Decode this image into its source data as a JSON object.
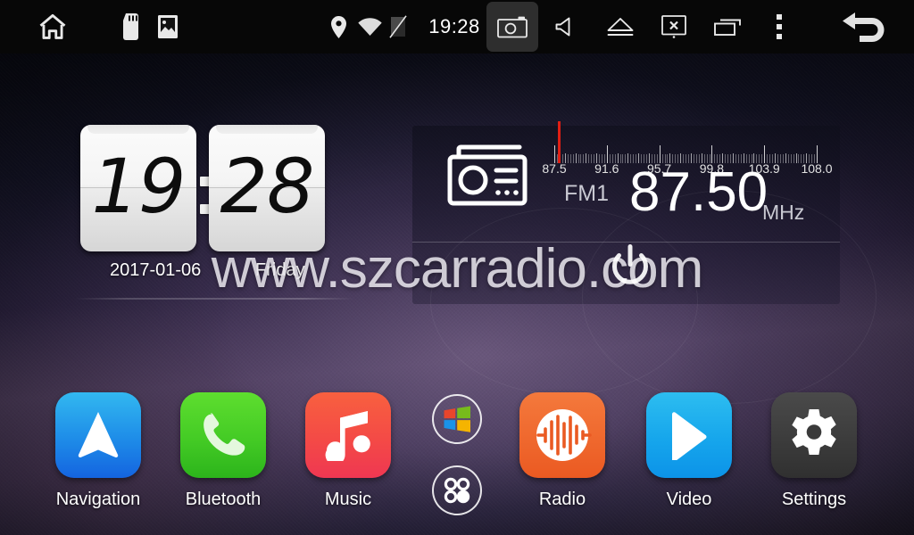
{
  "statusbar": {
    "time": "19:28",
    "icons_left": [
      {
        "name": "home-icon",
        "label": "Home"
      },
      {
        "name": "sd-card-icon",
        "label": "SD Card"
      },
      {
        "name": "gallery-icon",
        "label": "Gallery"
      }
    ],
    "icons_center": [
      {
        "name": "location-pin-icon",
        "label": "Location"
      },
      {
        "name": "wifi-icon",
        "label": "Wi-Fi"
      },
      {
        "name": "sim-off-icon",
        "label": "No SIM"
      }
    ],
    "icons_right": [
      {
        "name": "camera-icon",
        "label": "Camera"
      },
      {
        "name": "volume-icon",
        "label": "Volume"
      },
      {
        "name": "eject-icon",
        "label": "Eject"
      },
      {
        "name": "screen-off-icon",
        "label": "Screen Off"
      },
      {
        "name": "recent-apps-icon",
        "label": "Recent Apps"
      },
      {
        "name": "overflow-menu-icon",
        "label": "More"
      },
      {
        "name": "back-icon",
        "label": "Back"
      }
    ]
  },
  "clock": {
    "hours": "19",
    "minutes": "28",
    "date": "2017-01-06",
    "weekday": "Friday"
  },
  "radio": {
    "icon_name": "radio-icon",
    "band": "FM1",
    "frequency": "87.50",
    "unit": "MHz",
    "scale_labels": [
      "87.5",
      "91.6",
      "95.7",
      "99.8",
      "103.9",
      "108.0"
    ],
    "scale_min": 87.5,
    "scale_max": 108.0,
    "needle_value": 87.5,
    "needle_color": "#e01f14"
  },
  "power": {
    "name": "power-button",
    "label": "Power"
  },
  "watermark": {
    "text": "www.szcarradio.com"
  },
  "dock": {
    "apps": [
      {
        "id": "navigation",
        "label": "Navigation",
        "icon": "navigation-arrow-icon",
        "color_top": "#32b8f0",
        "color_bottom": "#1464e0"
      },
      {
        "id": "bluetooth",
        "label": "Bluetooth",
        "icon": "phone-handset-icon",
        "color_top": "#5ede2f",
        "color_bottom": "#2cb41b"
      },
      {
        "id": "music",
        "label": "Music",
        "icon": "music-note-icon",
        "color_top": "#f8603f",
        "color_bottom": "#ef3752"
      },
      {
        "id": "radio",
        "label": "Radio",
        "icon": "waveform-icon",
        "color_top": "#f4793c",
        "color_bottom": "#eb5a22"
      },
      {
        "id": "video",
        "label": "Video",
        "icon": "play-triangle-icon",
        "color_top": "#2dbdf0",
        "color_bottom": "#0c93e8"
      },
      {
        "id": "settings",
        "label": "Settings",
        "icon": "gear-icon",
        "color_top": "#444444",
        "color_bottom": "#333333"
      }
    ],
    "circle_buttons": [
      {
        "id": "windows",
        "icon": "windows-logo-icon",
        "label": "Windows"
      },
      {
        "id": "allapps",
        "icon": "apps-grid-icon",
        "label": "All Apps"
      }
    ]
  }
}
